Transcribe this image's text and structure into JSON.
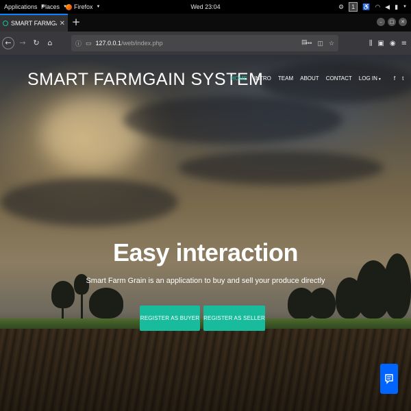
{
  "system_bar": {
    "applications": "Applications",
    "places": "Places",
    "firefox": "Firefox",
    "clock": "Wed 23:04",
    "workspace": "1"
  },
  "browser": {
    "tab_title": "SMART FARMGAIN SYS",
    "url_host": "127.0.0.1",
    "url_path": "/web/index.php",
    "accent": "#0a84ff"
  },
  "site": {
    "brand": "SMART FARMGAIN SYSTEM",
    "nav": [
      "HOME",
      "INTRO",
      "TEAM",
      "ABOUT",
      "CONTACT",
      "LOG IN"
    ],
    "social": [
      "f",
      "t"
    ],
    "hero_title": "Easy interaction",
    "hero_subtitle": "Smart Farm Grain is an application to buy and sell your produce directly",
    "btn_buyer": "REGISTER AS BUYER",
    "btn_seller": "REGISTER AS SELLER",
    "accent": "#1bbd9e",
    "button_color": "#18bc9c",
    "chat_color": "#0064ff"
  }
}
